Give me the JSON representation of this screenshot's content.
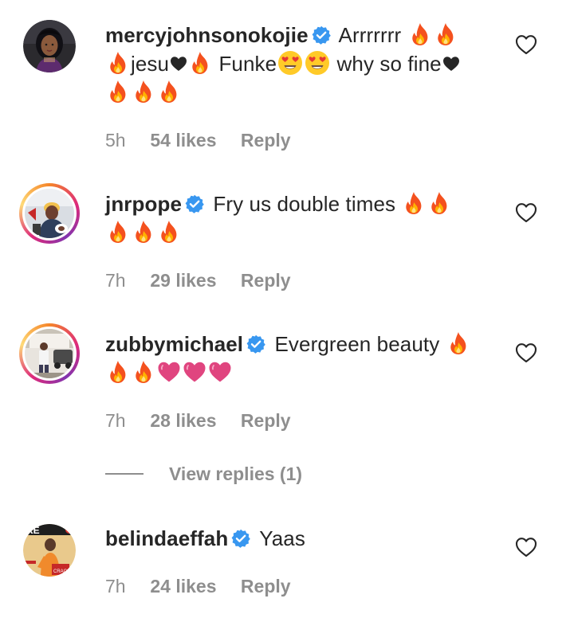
{
  "comments": [
    {
      "username": "mercyjohnsonokojie",
      "verified": true,
      "text_parts": [
        "Arrrrrrr",
        "jesu",
        "Funke",
        "why so fine"
      ],
      "time": "5h",
      "likes": "54 likes",
      "reply": "Reply"
    },
    {
      "username": "jnrpope",
      "verified": true,
      "text_parts": [
        "Fry us double times"
      ],
      "time": "7h",
      "likes": "29 likes",
      "reply": "Reply"
    },
    {
      "username": "zubbymichael",
      "verified": true,
      "text_parts": [
        "Evergreen beauty"
      ],
      "time": "7h",
      "likes": "28 likes",
      "reply": "Reply"
    },
    {
      "username": "belindaeffah",
      "verified": true,
      "text_parts": [
        "Yaas"
      ],
      "time": "7h",
      "likes": "24 likes",
      "reply": "Reply"
    }
  ],
  "view_replies": "View replies (1)",
  "avatar_4_lettering": "RE",
  "avatar_4_badge_lettering": "CRAC",
  "icons": {
    "verified": "verified-badge-icon",
    "like": "heart-outline-icon",
    "fire": "fire-emoji",
    "red_heart": "red-heart-emoji",
    "heart_eyes": "heart-eyes-emoji",
    "pink_heart": "pink-heart-emoji"
  },
  "colors": {
    "text": "#262626",
    "secondary": "#8e8e8e",
    "verified_blue": "#3897f0"
  }
}
